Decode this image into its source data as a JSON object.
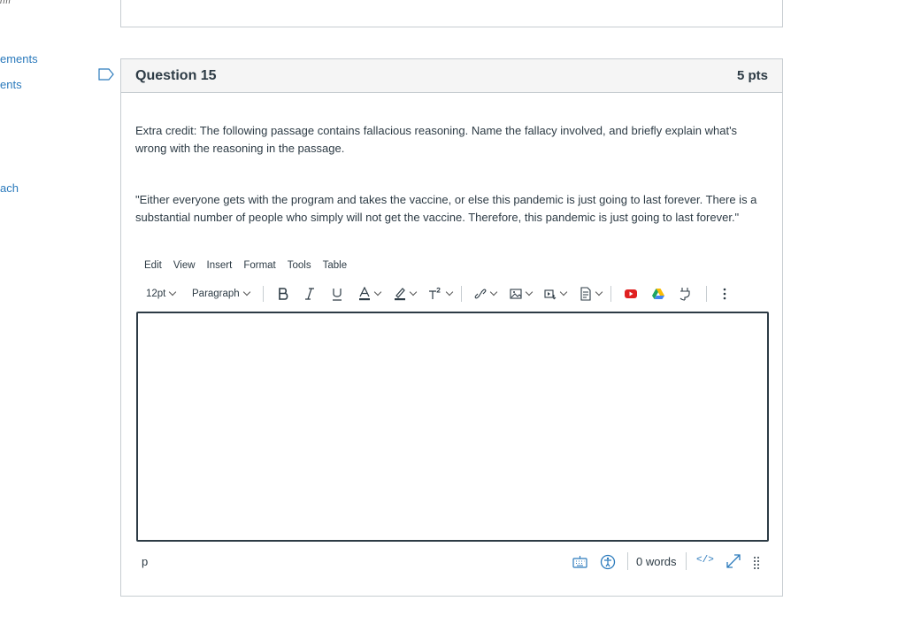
{
  "sidebar": {
    "top_fragment": "rm",
    "items": [
      {
        "label": "ements"
      },
      {
        "label": "ents"
      },
      {
        "label": "ach"
      }
    ]
  },
  "question": {
    "title": "Question 15",
    "points": "5 pts",
    "prompt_line1": "Extra credit: The following passage contains fallacious reasoning. Name the fallacy involved, and briefly explain what's",
    "prompt_line2": "wrong with the reasoning in the passage.",
    "passage_line1": "\"Either everyone gets with the program and takes the vaccine, or else this pandemic is just going to last forever. There is a",
    "passage_line2": "substantial number of people who simply will not get the vaccine. Therefore, this pandemic is just going to last forever.\""
  },
  "editor": {
    "menu": [
      "Edit",
      "View",
      "Insert",
      "Format",
      "Tools",
      "Table"
    ],
    "font_size": "12pt",
    "block_format": "Paragraph",
    "value": "",
    "status_path": "p",
    "word_count": "0 words",
    "html_toggle": "</>"
  },
  "colors": {
    "link": "#2b7abc",
    "text": "#2d3b45",
    "border": "#c7cdd1",
    "header_bg": "#f5f5f5",
    "youtube": "#e02020"
  }
}
